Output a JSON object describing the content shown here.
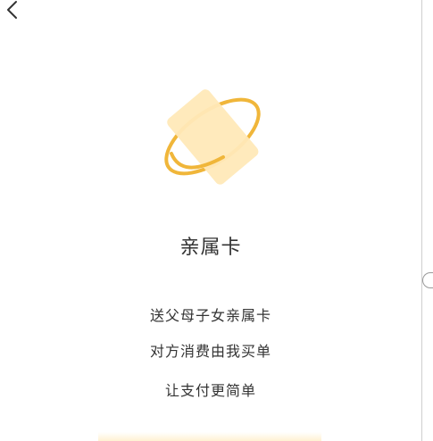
{
  "nav": {
    "back_icon": "chevron-left-icon"
  },
  "hero": {
    "icon": "card-orbit-icon",
    "card_color": "#FFE9B8",
    "orbit_color": "#F0B63A"
  },
  "title": "亲属卡",
  "description": [
    "送父母子女亲属卡",
    "对方消费由我买单",
    "让支付更简单"
  ]
}
